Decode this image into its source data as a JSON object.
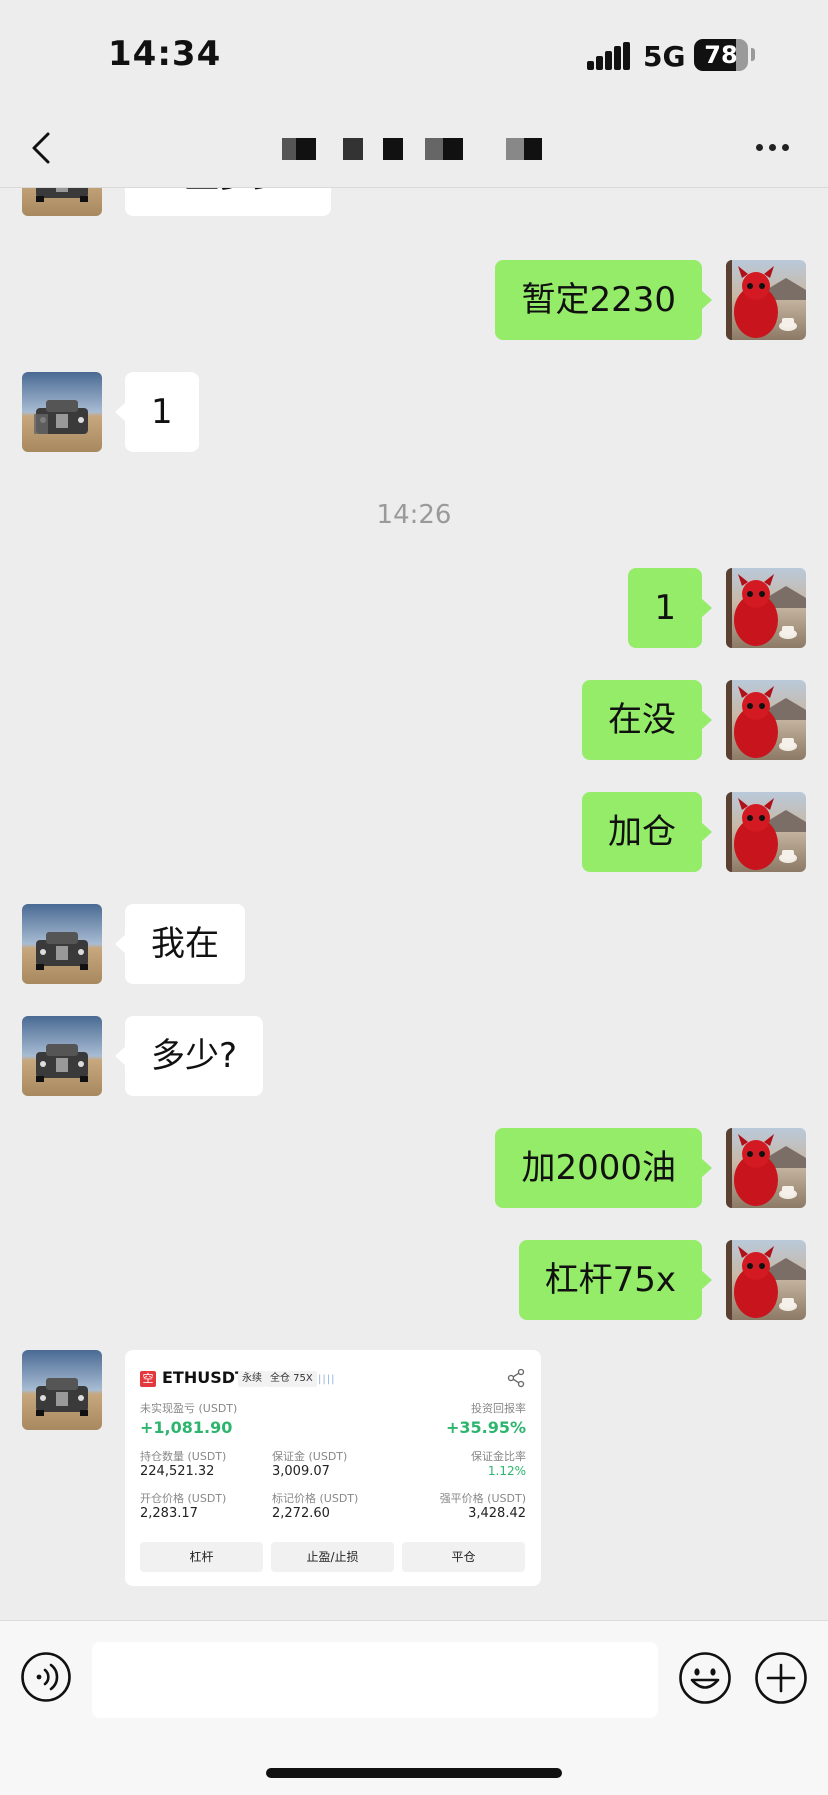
{
  "status": {
    "time": "14:34",
    "network": "5G",
    "battery_percent": "78",
    "battery_level": 0.78
  },
  "nav": {
    "title_obscured": true
  },
  "messages": {
    "top_partial": "止盈多少?",
    "m1": "暂定2230",
    "m2": "1",
    "timestamp": "14:26",
    "m3": "1",
    "m4": "在没",
    "m5": "加仓",
    "m6": "我在",
    "m7": "多少?",
    "m8": "加2000油",
    "m9": "杠杆75x"
  },
  "card": {
    "logo": "空",
    "symbol": "ETHUSDT",
    "tag_perpetual": "永续",
    "tag_margin": "全仓 75X",
    "bars": "||||",
    "unrealized_label": "未实现盈亏 (USDT)",
    "unrealized_value": "+1,081.90",
    "roi_label": "投资回报率",
    "roi_value": "+35.95%",
    "position_label": "持仓数量 (USDT)",
    "position_value": "224,521.32",
    "margin_label": "保证金 (USDT)",
    "margin_value": "3,009.07",
    "margin_ratio_label": "保证金比率",
    "margin_ratio_value": "1.12%",
    "entry_label": "开仓价格 (USDT)",
    "entry_value": "2,283.17",
    "mark_label": "标记价格 (USDT)",
    "mark_value": "2,272.60",
    "liq_label": "强平价格 (USDT)",
    "liq_value": "3,428.42",
    "btn_leverage": "杠杆",
    "btn_tpsl": "止盈/止损",
    "btn_close": "平仓"
  },
  "colors": {
    "outgoing_bubble": "#95ec69",
    "incoming_bubble": "#ffffff",
    "background": "#ededed",
    "profit_green": "#2db56d"
  }
}
